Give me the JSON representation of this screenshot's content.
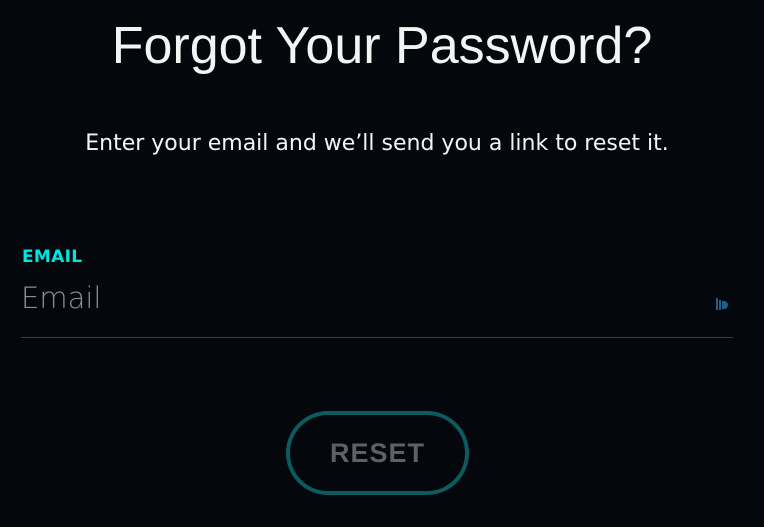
{
  "page": {
    "title": "Forgot Your Password?",
    "subtitle": "Enter your email and we’ll send you a link to reset it."
  },
  "form": {
    "email": {
      "label": "EMAIL",
      "placeholder": "Email",
      "value": ""
    },
    "password_manager_icon": "password-manager-icon",
    "reset_label": "RESET"
  },
  "colors": {
    "background": "#04070c",
    "accent": "#00e5e0",
    "button_border": "#0b5c5f",
    "button_text_disabled": "#5d6064",
    "placeholder": "#8e8f93"
  }
}
